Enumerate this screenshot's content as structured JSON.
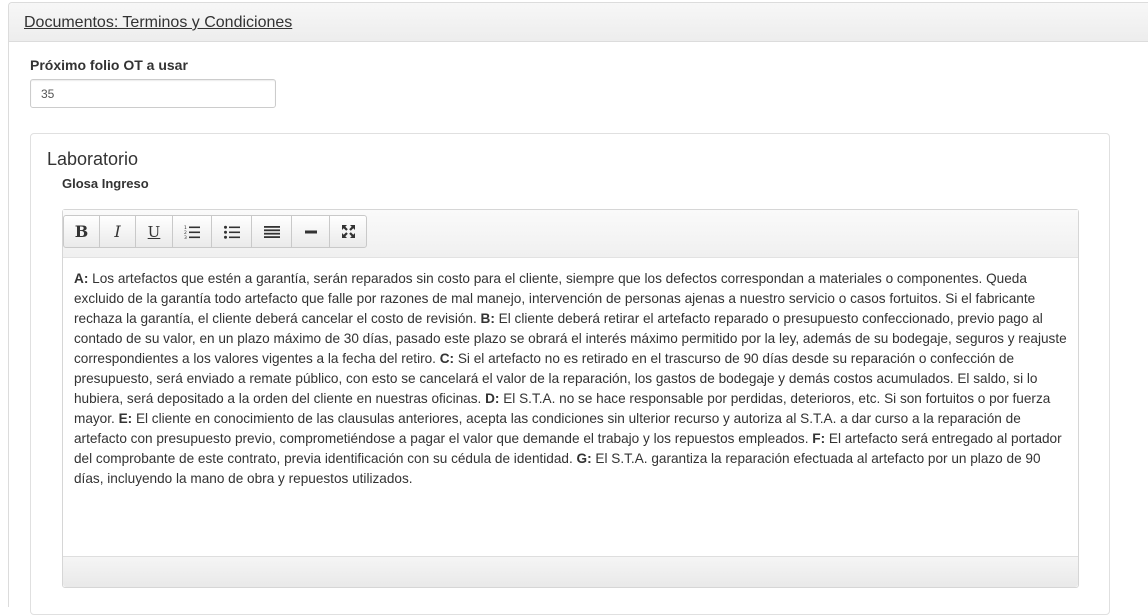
{
  "panel": {
    "title": "Documentos: Terminos y Condiciones"
  },
  "folio": {
    "label": "Próximo folio OT a usar",
    "value": "35"
  },
  "laboratorio": {
    "title": "Laboratorio",
    "glosa_label": "Glosa Ingreso"
  },
  "toolbar": {
    "bold": "B",
    "italic": "I",
    "underline": "U",
    "ordered_list_icon": "ordered-list-icon",
    "unordered_list_icon": "unordered-list-icon",
    "justify_icon": "justify-icon",
    "horizontal_rule_icon": "horizontal-rule-icon",
    "fullscreen_icon": "fullscreen-icon"
  },
  "glosa": {
    "clauses": [
      {
        "key": "A:",
        "text": " Los artefactos que estén a garantía, serán reparados sin costo para el cliente, siempre que los defectos correspondan a materiales o componentes. Queda excluido de la garantía todo artefacto que falle por razones de mal manejo, intervención de personas ajenas a nuestro servicio o casos fortuitos. Si el fabricante rechaza la garantía, el cliente deberá cancelar el costo de revisión. "
      },
      {
        "key": "B:",
        "text": " El cliente deberá retirar el artefacto reparado o presupuesto confeccionado, previo pago al contado de su valor, en un plazo máximo de 30 días, pasado este plazo se obrará el interés máximo permitido por la ley, además de su bodegaje, seguros y reajuste correspondientes a los valores vigentes a la fecha del retiro. "
      },
      {
        "key": "C:",
        "text": " Si el artefacto no es retirado en el trascurso de 90 días desde su reparación o confección de presupuesto, será enviado a remate público, con esto se cancelará el valor de la reparación, los gastos de bodegaje y demás costos acumulados. El saldo, si lo hubiera, será depositado a la orden del cliente en nuestras oficinas. "
      },
      {
        "key": "D:",
        "text": " El S.T.A. no se hace responsable por perdidas, deterioros, etc. Si son fortuitos o por fuerza mayor. "
      },
      {
        "key": "E:",
        "text": " El cliente en conocimiento de las clausulas anteriores, acepta las condiciones sin ulterior recurso y autoriza al S.T.A. a dar curso a la reparación de artefacto con presupuesto previo, comprometiéndose a pagar el valor que demande el trabajo y los repuestos empleados. "
      },
      {
        "key": "F:",
        "text": " El artefacto será entregado al portador del comprobante de este contrato, previa identificación con su cédula de identidad. "
      },
      {
        "key": "G:",
        "text": " El S.T.A. garantiza la reparación efectuada al artefacto por un plazo de 90 días, incluyendo la mano de obra y repuestos utilizados."
      }
    ]
  }
}
